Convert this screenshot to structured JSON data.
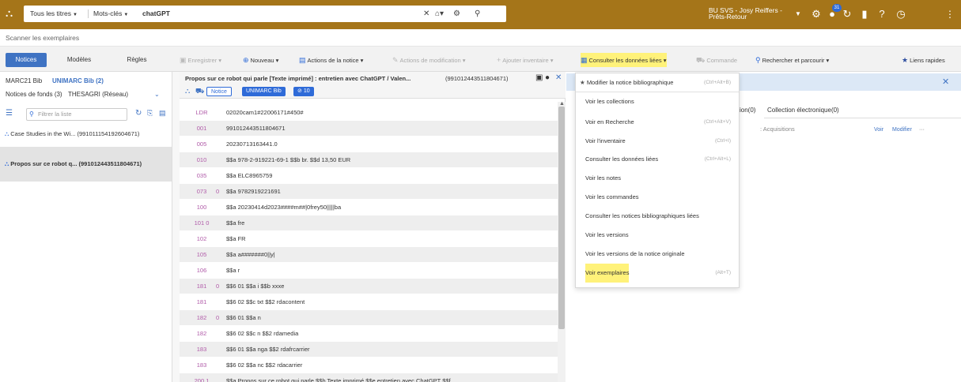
{
  "topbar": {
    "search_scope": "Tous les titres",
    "search_field": "Mots-clés",
    "search_query": "chatGPT",
    "user_line1": "BU SVS - Josy Reiffers -",
    "user_line2": "Prêts-Retour",
    "notif_badge": "31"
  },
  "scan": {
    "label": "Scanner les exemplaires"
  },
  "toolbar": {
    "tabs": [
      "Notices",
      "Modèles",
      "Règles"
    ],
    "enregistrer": "Enregistrer",
    "nouveau": "Nouveau",
    "actions_notice": "Actions de la notice",
    "actions_modif": "Actions de modification",
    "ajouter_inventaire": "Ajouter inventaire",
    "consulter": "Consulter les données liées",
    "commande": "Commande",
    "rechercher": "Rechercher et parcourir",
    "liens_rapides": "Liens rapides"
  },
  "left": {
    "tab_marc21": "MARC21 Bib",
    "tab_unimarc": "UNIMARC Bib (2)",
    "tab_fonds": "Notices de fonds (3)",
    "tab_thesagri": "THESAGRI (Réseau)",
    "filter_placeholder": "Filtrer la liste",
    "items": [
      "Case Studies in the Wi...  (991011154192604671)",
      "Propos sur ce robot q...  (991012443511804671)"
    ]
  },
  "center": {
    "title": "Propos sur ce robot qui parle [Texte imprimé] : entretien avec ChatGPT / Valen...",
    "mms": "(991012443511804671)",
    "chip_notice": "Notice",
    "chip_format": "UNIMARC Bib",
    "chip_count": "10",
    "rows": [
      {
        "tag": "LDR",
        "ind": "",
        "val": "02020cam1#22006171#450#"
      },
      {
        "tag": "001",
        "ind": "",
        "val": "991012443511804671"
      },
      {
        "tag": "005",
        "ind": "",
        "val": "20230713163441.0"
      },
      {
        "tag": "010",
        "ind": "",
        "val": "$$a 978-2-919221-69-1 $$b br. $$d 13,50 EUR"
      },
      {
        "tag": "035",
        "ind": "",
        "val": "$$a ELC8965759"
      },
      {
        "tag": "073",
        "ind": "0",
        "val": "$$a 9782919221691"
      },
      {
        "tag": "100",
        "ind": "",
        "val": "$$a 20230414d2023####m##|0frey50|||||ba"
      },
      {
        "tag": "101 0",
        "ind": "",
        "val": "$$a fre"
      },
      {
        "tag": "102",
        "ind": "",
        "val": "$$a FR"
      },
      {
        "tag": "105",
        "ind": "",
        "val": "$$a a#######0||y|"
      },
      {
        "tag": "106",
        "ind": "",
        "val": "$$a r"
      },
      {
        "tag": "181",
        "ind": "0",
        "val": "$$6 01 $$a i $$b xxxe"
      },
      {
        "tag": "181",
        "ind": "",
        "val": "$$6 02 $$c txt $$2 rdacontent"
      },
      {
        "tag": "182",
        "ind": "0",
        "val": "$$6 01 $$a n"
      },
      {
        "tag": "182",
        "ind": "",
        "val": "$$6 02 $$c n $$2 rdamedia"
      },
      {
        "tag": "183",
        "ind": "",
        "val": "$$6 01 $$a nga $$2 rdafrcarrier"
      },
      {
        "tag": "183",
        "ind": "",
        "val": "$$6 02 $$a nc $$2 rdacarrier"
      },
      {
        "tag": "200 1",
        "ind": "",
        "val": "$$a Propos sur ce robot qui parle $$b Texte imprimé $$e entretien avec ChatGPT $$f"
      }
    ]
  },
  "right": {
    "tab_ion": "ion(0)",
    "tab_collection": "Collection électronique(0)",
    "acquisitions": "Acquisitions",
    "voir": "Voir",
    "modifier": "Modifier",
    "more": "···"
  },
  "menu": {
    "items": [
      {
        "label": "Modifier la notice bibliographique",
        "key": "(Ctrl+Alt+B)"
      },
      {
        "label": "Voir les collections",
        "key": ""
      },
      {
        "label": "Voir en Recherche",
        "key": "(Ctrl+Alt+V)"
      },
      {
        "label": "Voir l'inventaire",
        "key": "(Ctrl+I)"
      },
      {
        "label": "Consulter les données liées",
        "key": "(Ctrl+Alt+L)"
      },
      {
        "label": "Voir les notes",
        "key": ""
      },
      {
        "label": "Voir les commandes",
        "key": ""
      },
      {
        "label": "Consulter les notices bibliographiques liées",
        "key": ""
      },
      {
        "label": "Voir les versions",
        "key": ""
      },
      {
        "label": "Voir les versions de la notice originale",
        "key": ""
      },
      {
        "label": "Voir exemplaires",
        "key": "(Alt+T)"
      }
    ]
  },
  "colors": {
    "topbar": "#a57519",
    "accent": "#3f73c3",
    "highlight": "#fff27a",
    "tag": "#b05aa8"
  }
}
